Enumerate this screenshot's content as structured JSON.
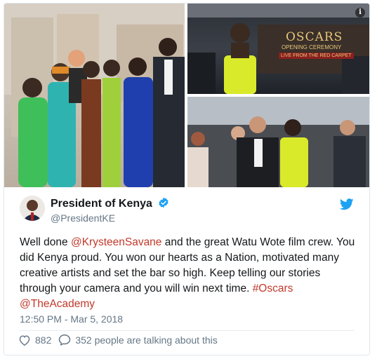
{
  "tweet": {
    "display_name": "President of Kenya",
    "handle": "@PresidentKE",
    "text_parts": {
      "p1": "Well done ",
      "mention1": "@KrysteenSavane",
      "p2": " and the great Watu Wote film crew. You did Kenya proud. You won our hearts as a Nation, motivated many creative artists and set the bar so high. Keep telling our stories through your camera and you will win next time. ",
      "hashtag": "#Oscars",
      "mention2": "@TheAcademy"
    },
    "timestamp": "12:50 PM - Mar 5, 2018",
    "likes": "882",
    "replies_text": "352 people are talking about this"
  },
  "media": {
    "oscars_sign": {
      "line1": "OSCARS",
      "line2": "OPENING CEREMONY",
      "line3": "LIVE FROM THE RED CARPET"
    }
  },
  "colors": {
    "verified": "#1da1f2",
    "twitter": "#1da1f2",
    "link": "#c0392b"
  }
}
